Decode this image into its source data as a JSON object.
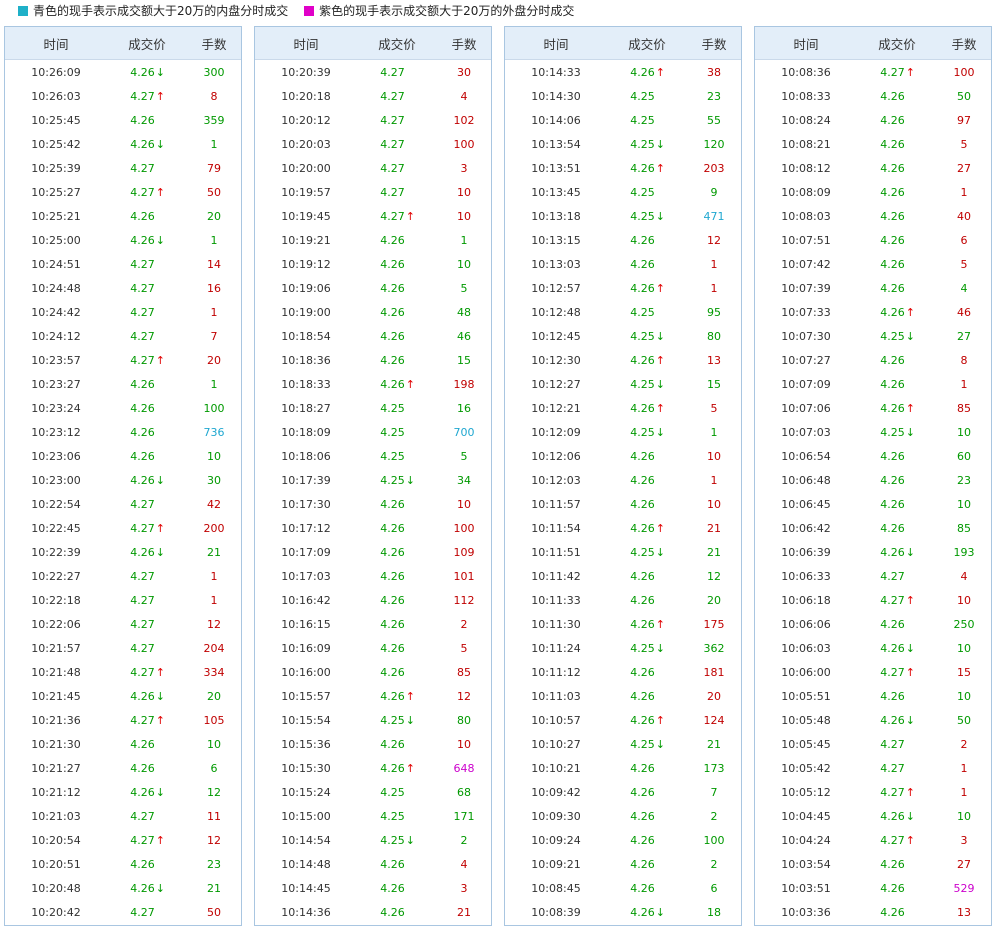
{
  "legend": {
    "items": [
      {
        "text": "青色的现手表示成交额大于20万的内盘分时成交",
        "color": "#1fb0c8"
      },
      {
        "text": "紫色的现手表示成交额大于20万的外盘分时成交",
        "color": "#e000c8"
      }
    ]
  },
  "table_header": {
    "time": "时间",
    "price": "成交价",
    "volume": "手数"
  },
  "columns": [
    [
      [
        "10:26:09",
        "4.26",
        "d",
        "300",
        "g"
      ],
      [
        "10:26:03",
        "4.27",
        "u",
        "8",
        "r"
      ],
      [
        "10:25:45",
        "4.26",
        "",
        "359",
        "g"
      ],
      [
        "10:25:42",
        "4.26",
        "d",
        "1",
        "g"
      ],
      [
        "10:25:39",
        "4.27",
        "",
        "79",
        "r"
      ],
      [
        "10:25:27",
        "4.27",
        "u",
        "50",
        "r"
      ],
      [
        "10:25:21",
        "4.26",
        "",
        "20",
        "g"
      ],
      [
        "10:25:00",
        "4.26",
        "d",
        "1",
        "g"
      ],
      [
        "10:24:51",
        "4.27",
        "",
        "14",
        "r"
      ],
      [
        "10:24:48",
        "4.27",
        "",
        "16",
        "r"
      ],
      [
        "10:24:42",
        "4.27",
        "",
        "1",
        "r"
      ],
      [
        "10:24:12",
        "4.27",
        "",
        "7",
        "r"
      ],
      [
        "10:23:57",
        "4.27",
        "u",
        "20",
        "r"
      ],
      [
        "10:23:27",
        "4.26",
        "",
        "1",
        "g"
      ],
      [
        "10:23:24",
        "4.26",
        "",
        "100",
        "g"
      ],
      [
        "10:23:12",
        "4.26",
        "",
        "736",
        "c"
      ],
      [
        "10:23:06",
        "4.26",
        "",
        "10",
        "g"
      ],
      [
        "10:23:00",
        "4.26",
        "d",
        "30",
        "g"
      ],
      [
        "10:22:54",
        "4.27",
        "",
        "42",
        "r"
      ],
      [
        "10:22:45",
        "4.27",
        "u",
        "200",
        "r"
      ],
      [
        "10:22:39",
        "4.26",
        "d",
        "21",
        "g"
      ],
      [
        "10:22:27",
        "4.27",
        "",
        "1",
        "r"
      ],
      [
        "10:22:18",
        "4.27",
        "",
        "1",
        "r"
      ],
      [
        "10:22:06",
        "4.27",
        "",
        "12",
        "r"
      ],
      [
        "10:21:57",
        "4.27",
        "",
        "204",
        "r"
      ],
      [
        "10:21:48",
        "4.27",
        "u",
        "334",
        "r"
      ],
      [
        "10:21:45",
        "4.26",
        "d",
        "20",
        "g"
      ],
      [
        "10:21:36",
        "4.27",
        "u",
        "105",
        "r"
      ],
      [
        "10:21:30",
        "4.26",
        "",
        "10",
        "g"
      ],
      [
        "10:21:27",
        "4.26",
        "",
        "6",
        "g"
      ],
      [
        "10:21:12",
        "4.26",
        "d",
        "12",
        "g"
      ],
      [
        "10:21:03",
        "4.27",
        "",
        "11",
        "r"
      ],
      [
        "10:20:54",
        "4.27",
        "u",
        "12",
        "r"
      ],
      [
        "10:20:51",
        "4.26",
        "",
        "23",
        "g"
      ],
      [
        "10:20:48",
        "4.26",
        "d",
        "21",
        "g"
      ],
      [
        "10:20:42",
        "4.27",
        "",
        "50",
        "r"
      ]
    ],
    [
      [
        "10:20:39",
        "4.27",
        "",
        "30",
        "r"
      ],
      [
        "10:20:18",
        "4.27",
        "",
        "4",
        "r"
      ],
      [
        "10:20:12",
        "4.27",
        "",
        "102",
        "r"
      ],
      [
        "10:20:03",
        "4.27",
        "",
        "100",
        "r"
      ],
      [
        "10:20:00",
        "4.27",
        "",
        "3",
        "r"
      ],
      [
        "10:19:57",
        "4.27",
        "",
        "10",
        "r"
      ],
      [
        "10:19:45",
        "4.27",
        "u",
        "10",
        "r"
      ],
      [
        "10:19:21",
        "4.26",
        "",
        "1",
        "g"
      ],
      [
        "10:19:12",
        "4.26",
        "",
        "10",
        "g"
      ],
      [
        "10:19:06",
        "4.26",
        "",
        "5",
        "g"
      ],
      [
        "10:19:00",
        "4.26",
        "",
        "48",
        "g"
      ],
      [
        "10:18:54",
        "4.26",
        "",
        "46",
        "g"
      ],
      [
        "10:18:36",
        "4.26",
        "",
        "15",
        "g"
      ],
      [
        "10:18:33",
        "4.26",
        "u",
        "198",
        "r"
      ],
      [
        "10:18:27",
        "4.25",
        "",
        "16",
        "g"
      ],
      [
        "10:18:09",
        "4.25",
        "",
        "700",
        "c"
      ],
      [
        "10:18:06",
        "4.25",
        "",
        "5",
        "g"
      ],
      [
        "10:17:39",
        "4.25",
        "d",
        "34",
        "g"
      ],
      [
        "10:17:30",
        "4.26",
        "",
        "10",
        "r"
      ],
      [
        "10:17:12",
        "4.26",
        "",
        "100",
        "r"
      ],
      [
        "10:17:09",
        "4.26",
        "",
        "109",
        "r"
      ],
      [
        "10:17:03",
        "4.26",
        "",
        "101",
        "r"
      ],
      [
        "10:16:42",
        "4.26",
        "",
        "112",
        "r"
      ],
      [
        "10:16:15",
        "4.26",
        "",
        "2",
        "r"
      ],
      [
        "10:16:09",
        "4.26",
        "",
        "5",
        "r"
      ],
      [
        "10:16:00",
        "4.26",
        "",
        "85",
        "r"
      ],
      [
        "10:15:57",
        "4.26",
        "u",
        "12",
        "r"
      ],
      [
        "10:15:54",
        "4.25",
        "d",
        "80",
        "g"
      ],
      [
        "10:15:36",
        "4.26",
        "",
        "10",
        "r"
      ],
      [
        "10:15:30",
        "4.26",
        "u",
        "648",
        "p"
      ],
      [
        "10:15:24",
        "4.25",
        "",
        "68",
        "g"
      ],
      [
        "10:15:00",
        "4.25",
        "",
        "171",
        "g"
      ],
      [
        "10:14:54",
        "4.25",
        "d",
        "2",
        "g"
      ],
      [
        "10:14:48",
        "4.26",
        "",
        "4",
        "r"
      ],
      [
        "10:14:45",
        "4.26",
        "",
        "3",
        "r"
      ],
      [
        "10:14:36",
        "4.26",
        "",
        "21",
        "r"
      ]
    ],
    [
      [
        "10:14:33",
        "4.26",
        "u",
        "38",
        "r"
      ],
      [
        "10:14:30",
        "4.25",
        "",
        "23",
        "g"
      ],
      [
        "10:14:06",
        "4.25",
        "",
        "55",
        "g"
      ],
      [
        "10:13:54",
        "4.25",
        "d",
        "120",
        "g"
      ],
      [
        "10:13:51",
        "4.26",
        "u",
        "203",
        "r"
      ],
      [
        "10:13:45",
        "4.25",
        "",
        "9",
        "g"
      ],
      [
        "10:13:18",
        "4.25",
        "d",
        "471",
        "c"
      ],
      [
        "10:13:15",
        "4.26",
        "",
        "12",
        "r"
      ],
      [
        "10:13:03",
        "4.26",
        "",
        "1",
        "r"
      ],
      [
        "10:12:57",
        "4.26",
        "u",
        "1",
        "r"
      ],
      [
        "10:12:48",
        "4.25",
        "",
        "95",
        "g"
      ],
      [
        "10:12:45",
        "4.25",
        "d",
        "80",
        "g"
      ],
      [
        "10:12:30",
        "4.26",
        "u",
        "13",
        "r"
      ],
      [
        "10:12:27",
        "4.25",
        "d",
        "15",
        "g"
      ],
      [
        "10:12:21",
        "4.26",
        "u",
        "5",
        "r"
      ],
      [
        "10:12:09",
        "4.25",
        "d",
        "1",
        "g"
      ],
      [
        "10:12:06",
        "4.26",
        "",
        "10",
        "r"
      ],
      [
        "10:12:03",
        "4.26",
        "",
        "1",
        "r"
      ],
      [
        "10:11:57",
        "4.26",
        "",
        "10",
        "r"
      ],
      [
        "10:11:54",
        "4.26",
        "u",
        "21",
        "r"
      ],
      [
        "10:11:51",
        "4.25",
        "d",
        "21",
        "g"
      ],
      [
        "10:11:42",
        "4.26",
        "",
        "12",
        "g"
      ],
      [
        "10:11:33",
        "4.26",
        "",
        "20",
        "g"
      ],
      [
        "10:11:30",
        "4.26",
        "u",
        "175",
        "r"
      ],
      [
        "10:11:24",
        "4.25",
        "d",
        "362",
        "g"
      ],
      [
        "10:11:12",
        "4.26",
        "",
        "181",
        "r"
      ],
      [
        "10:11:03",
        "4.26",
        "",
        "20",
        "r"
      ],
      [
        "10:10:57",
        "4.26",
        "u",
        "124",
        "r"
      ],
      [
        "10:10:27",
        "4.25",
        "d",
        "21",
        "g"
      ],
      [
        "10:10:21",
        "4.26",
        "",
        "173",
        "g"
      ],
      [
        "10:09:42",
        "4.26",
        "",
        "7",
        "g"
      ],
      [
        "10:09:30",
        "4.26",
        "",
        "2",
        "g"
      ],
      [
        "10:09:24",
        "4.26",
        "",
        "100",
        "g"
      ],
      [
        "10:09:21",
        "4.26",
        "",
        "2",
        "g"
      ],
      [
        "10:08:45",
        "4.26",
        "",
        "6",
        "g"
      ],
      [
        "10:08:39",
        "4.26",
        "d",
        "18",
        "g"
      ]
    ],
    [
      [
        "10:08:36",
        "4.27",
        "u",
        "100",
        "r"
      ],
      [
        "10:08:33",
        "4.26",
        "",
        "50",
        "g"
      ],
      [
        "10:08:24",
        "4.26",
        "",
        "97",
        "r"
      ],
      [
        "10:08:21",
        "4.26",
        "",
        "5",
        "r"
      ],
      [
        "10:08:12",
        "4.26",
        "",
        "27",
        "r"
      ],
      [
        "10:08:09",
        "4.26",
        "",
        "1",
        "r"
      ],
      [
        "10:08:03",
        "4.26",
        "",
        "40",
        "r"
      ],
      [
        "10:07:51",
        "4.26",
        "",
        "6",
        "r"
      ],
      [
        "10:07:42",
        "4.26",
        "",
        "5",
        "r"
      ],
      [
        "10:07:39",
        "4.26",
        "",
        "4",
        "g"
      ],
      [
        "10:07:33",
        "4.26",
        "u",
        "46",
        "r"
      ],
      [
        "10:07:30",
        "4.25",
        "d",
        "27",
        "g"
      ],
      [
        "10:07:27",
        "4.26",
        "",
        "8",
        "r"
      ],
      [
        "10:07:09",
        "4.26",
        "",
        "1",
        "r"
      ],
      [
        "10:07:06",
        "4.26",
        "u",
        "85",
        "r"
      ],
      [
        "10:07:03",
        "4.25",
        "d",
        "10",
        "g"
      ],
      [
        "10:06:54",
        "4.26",
        "",
        "60",
        "g"
      ],
      [
        "10:06:48",
        "4.26",
        "",
        "23",
        "g"
      ],
      [
        "10:06:45",
        "4.26",
        "",
        "10",
        "g"
      ],
      [
        "10:06:42",
        "4.26",
        "",
        "85",
        "g"
      ],
      [
        "10:06:39",
        "4.26",
        "d",
        "193",
        "g"
      ],
      [
        "10:06:33",
        "4.27",
        "",
        "4",
        "r"
      ],
      [
        "10:06:18",
        "4.27",
        "u",
        "10",
        "r"
      ],
      [
        "10:06:06",
        "4.26",
        "",
        "250",
        "g"
      ],
      [
        "10:06:03",
        "4.26",
        "d",
        "10",
        "g"
      ],
      [
        "10:06:00",
        "4.27",
        "u",
        "15",
        "r"
      ],
      [
        "10:05:51",
        "4.26",
        "",
        "10",
        "g"
      ],
      [
        "10:05:48",
        "4.26",
        "d",
        "50",
        "g"
      ],
      [
        "10:05:45",
        "4.27",
        "",
        "2",
        "r"
      ],
      [
        "10:05:42",
        "4.27",
        "",
        "1",
        "r"
      ],
      [
        "10:05:12",
        "4.27",
        "u",
        "1",
        "r"
      ],
      [
        "10:04:45",
        "4.26",
        "d",
        "10",
        "g"
      ],
      [
        "10:04:24",
        "4.27",
        "u",
        "3",
        "r"
      ],
      [
        "10:03:54",
        "4.26",
        "",
        "27",
        "r"
      ],
      [
        "10:03:51",
        "4.26",
        "",
        "529",
        "p"
      ],
      [
        "10:03:36",
        "4.26",
        "",
        "13",
        "r"
      ]
    ]
  ]
}
